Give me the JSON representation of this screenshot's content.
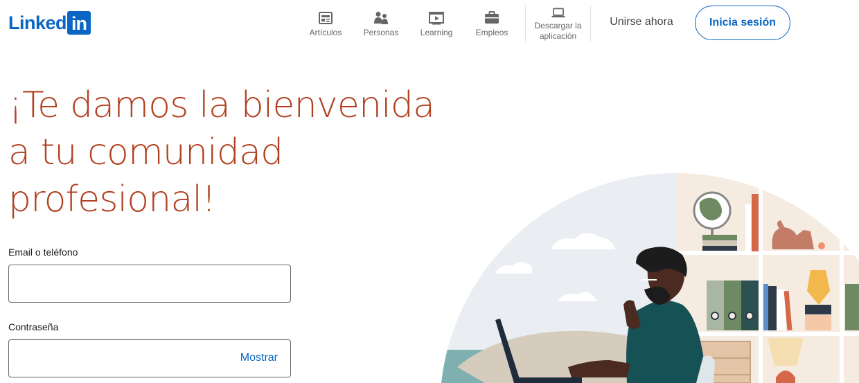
{
  "brand": {
    "logo_text": "Linked",
    "logo_box": "in",
    "color": "#0a66c2"
  },
  "nav": {
    "items": [
      {
        "label": "Artículos",
        "icon": "articles-icon"
      },
      {
        "label": "Personas",
        "icon": "people-icon"
      },
      {
        "label": "Learning",
        "icon": "learning-icon"
      },
      {
        "label": "Empleos",
        "icon": "jobs-icon"
      }
    ],
    "download": {
      "line1": "Descargar la",
      "line2": "aplicación",
      "icon": "laptop-icon"
    },
    "join_label": "Unirse ahora",
    "signin_label": "Inicia sesión"
  },
  "hero": {
    "line1": "¡Te damos la bienvenida",
    "line2": "a tu comunidad",
    "line3": "profesional!",
    "color": "#b24020"
  },
  "form": {
    "email_label": "Email o teléfono",
    "email_value": "",
    "password_label": "Contraseña",
    "password_value": "",
    "show_label": "Mostrar"
  }
}
